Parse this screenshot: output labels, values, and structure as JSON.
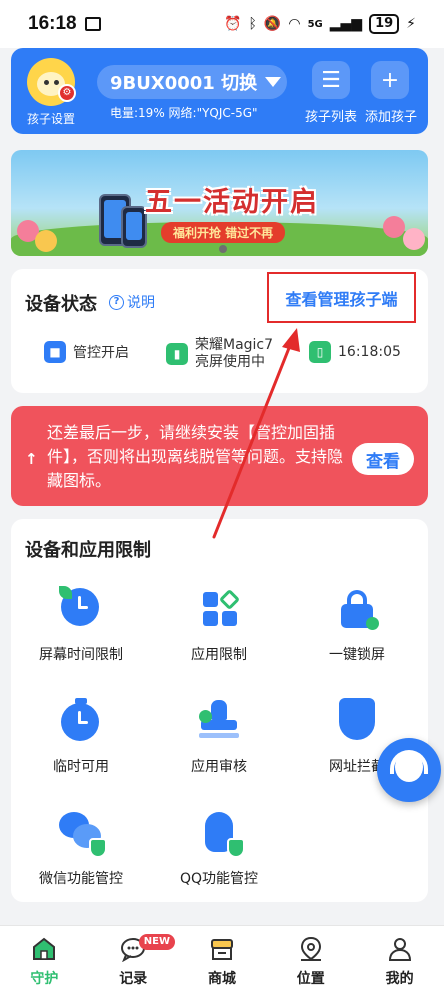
{
  "status_bar": {
    "time": "16:18",
    "network": "5G",
    "battery": "19"
  },
  "header": {
    "child_settings_label": "孩子设置",
    "device_name": "9BUX0001 切换",
    "device_info": "电量:19% 网络:\"YQJC-5G\"",
    "child_list_label": "孩子列表",
    "add_child_label": "添加孩子"
  },
  "banner": {
    "title": "五一活动开启",
    "subtitle": "福利开抢 错过不再"
  },
  "device_status": {
    "title": "设备状态",
    "help_label": "说明",
    "view_link": "查看管理孩子端",
    "items": [
      {
        "label": "管控开启",
        "icon": "shield-icon"
      },
      {
        "label": "荣耀Magic7",
        "sub": "亮屏使用中",
        "icon": "signal-icon"
      },
      {
        "label": "16:18:05",
        "icon": "phone-icon"
      }
    ]
  },
  "warning": {
    "text": "还差最后一步，请继续安装【管控加固插件】，否则将出现离线脱管等问题。支持隐藏图标。",
    "button": "查看"
  },
  "restrictions": {
    "title": "设备和应用限制",
    "items": [
      {
        "label": "屏幕时间限制",
        "icon": "clock-icon"
      },
      {
        "label": "应用限制",
        "icon": "apps-icon"
      },
      {
        "label": "一键锁屏",
        "icon": "lock-icon"
      },
      {
        "label": "临时可用",
        "icon": "timer-icon"
      },
      {
        "label": "应用审核",
        "icon": "stamp-icon"
      },
      {
        "label": "网址拦截",
        "icon": "shield-icon"
      },
      {
        "label": "微信功能管控",
        "icon": "wechat-icon"
      },
      {
        "label": "QQ功能管控",
        "icon": "qq-icon"
      }
    ]
  },
  "bottom_nav": [
    {
      "label": "守护",
      "icon": "home-icon",
      "active": true
    },
    {
      "label": "记录",
      "icon": "chat-icon",
      "badge": "NEW"
    },
    {
      "label": "商城",
      "icon": "store-icon"
    },
    {
      "label": "位置",
      "icon": "location-icon"
    },
    {
      "label": "我的",
      "icon": "user-icon"
    }
  ],
  "colors": {
    "primary": "#2f7cf6",
    "warning": "#f0535c",
    "active_nav": "#2fbf71",
    "annotation": "#e32b2b"
  }
}
